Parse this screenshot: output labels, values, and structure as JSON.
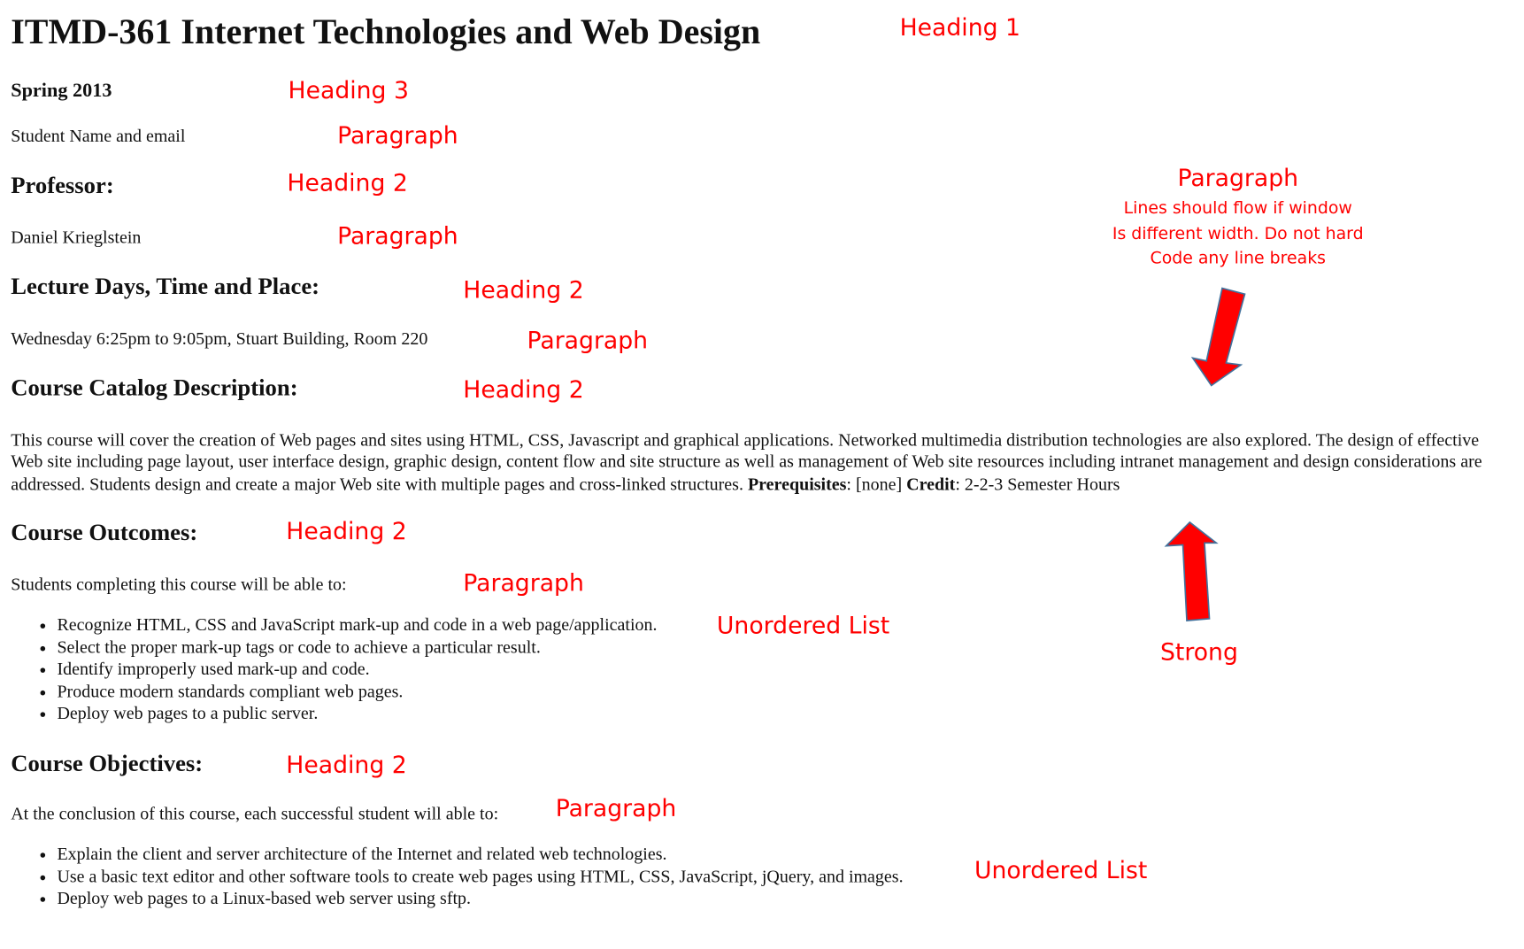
{
  "document": {
    "title": "ITMD-361 Internet Technologies and Web Design",
    "term": "Spring 2013",
    "student": "Student Name and email",
    "professor_heading": "Professor:",
    "professor": "Daniel Krieglstein",
    "lecture_heading": "Lecture Days, Time and Place:",
    "lecture": "Wednesday 6:25pm to 9:05pm, Stuart Building, Room 220",
    "catalog_heading": "Course Catalog Description:",
    "catalog_text": "This course will cover the creation of Web pages and sites using HTML, CSS, Javascript and graphical applications. Networked multimedia distribution technologies are also explored. The design of effective Web site including page layout, user interface design, graphic design, content flow and site structure as well as management of Web site resources including intranet management and design considerations are addressed. Students design and create a major Web site with multiple pages and cross-linked structures.",
    "prereq_label": "Prerequisites",
    "prereq_value": ": [none] ",
    "credit_label": "Credit",
    "credit_value": ": 2-2-3 Semester Hours",
    "outcomes_heading": "Course Outcomes:",
    "outcomes_intro": "Students completing this course will be able to:",
    "outcomes": [
      "Recognize HTML, CSS and JavaScript mark-up and code in a web page/application.",
      "Select the proper mark-up tags or code to achieve a particular result.",
      "Identify improperly used mark-up and code.",
      "Produce modern standards compliant web pages.",
      "Deploy web pages to a public server."
    ],
    "objectives_heading": "Course Objectives:",
    "objectives_intro": "At the conclusion of this course, each successful student will able to:",
    "objectives": [
      "Explain the client and server architecture of the Internet and related web technologies.",
      "Use a basic text editor and other software tools to create web pages using HTML, CSS, JavaScript, jQuery, and images.",
      "Deploy web pages to a Linux-based web server using sftp."
    ]
  },
  "annotations": {
    "h1": "Heading 1",
    "h3": "Heading 3",
    "p": "Paragraph",
    "h2": "Heading 2",
    "ul": "Unordered List",
    "strong": "Strong",
    "note_title": "Paragraph",
    "note_lines": [
      "Lines should flow if window",
      "Is different width. Do not hard",
      "Code any line breaks"
    ]
  },
  "colors": {
    "annotation": "#ff0000",
    "arrow_stroke": "#41719c"
  }
}
